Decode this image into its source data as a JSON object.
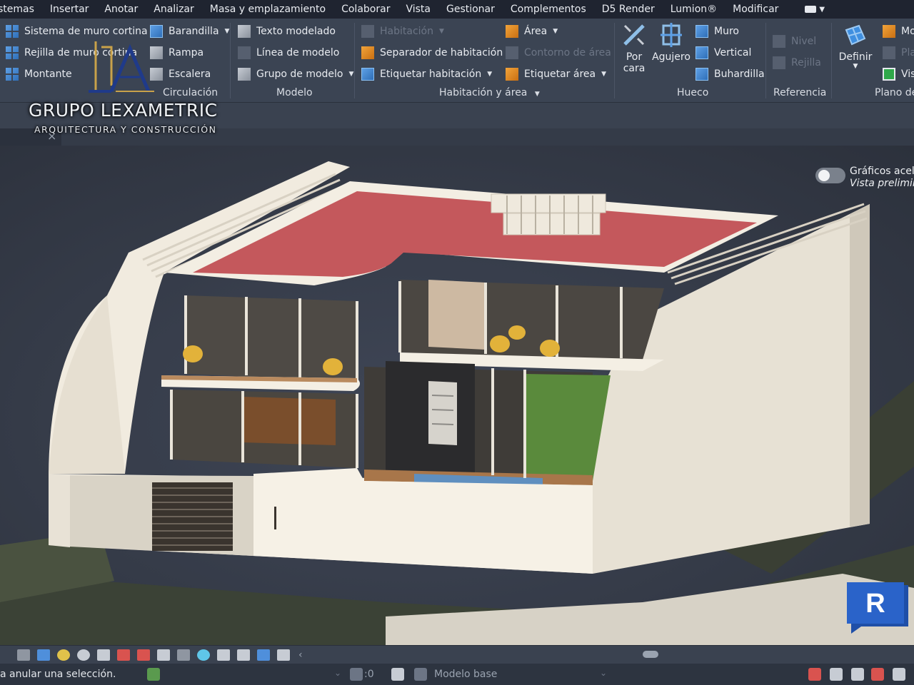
{
  "menu": {
    "items": [
      "stemas",
      "Insertar",
      "Anotar",
      "Analizar",
      "Masa y emplazamiento",
      "Colaborar",
      "Vista",
      "Gestionar",
      "Complementos",
      "D5 Render",
      "Lumion®",
      "Modificar"
    ]
  },
  "ribbon": {
    "construir": {
      "sistema_muro_cortina": "Sistema de muro cortina",
      "rejilla_muro_cortina": "Rejilla de muro cortina",
      "montante": "Montante"
    },
    "circulacion": {
      "barandilla": "Barandilla",
      "rampa": "Rampa",
      "escalera": "Escalera",
      "label": "Circulación"
    },
    "modelo": {
      "texto_modelado": "Texto modelado",
      "linea_modelo": "Línea de modelo",
      "grupo_modelo": "Grupo de modelo",
      "label": "Modelo"
    },
    "habitacion_area": {
      "habitacion": "Habitación",
      "separador": "Separador de habitación",
      "etiquetar_habitacion": "Etiquetar habitación",
      "area": "Área",
      "contorno_area": "Contorno de área",
      "etiquetar_area": "Etiquetar área",
      "label": "Habitación y área"
    },
    "hueco": {
      "por_cara_1": "Por",
      "por_cara_2": "cara",
      "agujero": "Agujero",
      "muro": "Muro",
      "vertical": "Vertical",
      "buhardilla": "Buhardilla",
      "label": "Hueco"
    },
    "referencia": {
      "nivel": "Nivel",
      "rejilla": "Rejilla",
      "label": "Referencia"
    },
    "plano_trabajo": {
      "definir": "Definir",
      "mo": "Mo",
      "pla": "Pla",
      "vis": "Vis",
      "label": "Plano de"
    }
  },
  "logo": {
    "name": "GRUPO LEXAMETRIC",
    "subtitle": "ARQUITECTURA Y CONSTRUCCIÓN"
  },
  "viewport": {
    "graphics_line1": "Gráficos acele",
    "graphics_line2": "Vista prelimin",
    "graphics_toggle_on": false
  },
  "status": {
    "message": "a anular una selección.",
    "count": ":0",
    "model": "Modelo base"
  },
  "colors": {
    "roof": "#c4585c",
    "walls": "#f1ebdf",
    "revit_badge": "#2a63c9"
  }
}
